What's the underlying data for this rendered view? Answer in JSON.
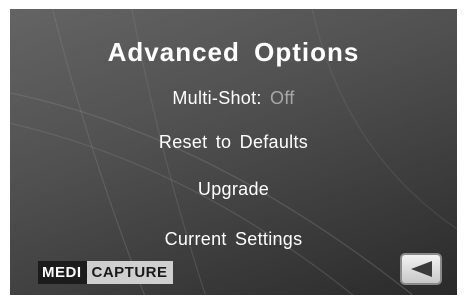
{
  "screen": {
    "title": "Advanced Options",
    "menu": [
      {
        "id": "multi-shot",
        "label": "Multi-Shot:",
        "value": "Off"
      },
      {
        "id": "reset",
        "label": "Reset to Defaults"
      },
      {
        "id": "upgrade",
        "label": "Upgrade"
      },
      {
        "id": "current-settings",
        "label": "Current Settings"
      }
    ]
  },
  "branding": {
    "logo_part1": "MEDI",
    "logo_part2": "CAPTURE"
  },
  "controls": {
    "back_icon": "left-triangle-icon"
  },
  "colors": {
    "background_light": "#646464",
    "background_dark": "#2a2a2a",
    "text": "#ffffff",
    "value_text": "#a8a8a8"
  }
}
